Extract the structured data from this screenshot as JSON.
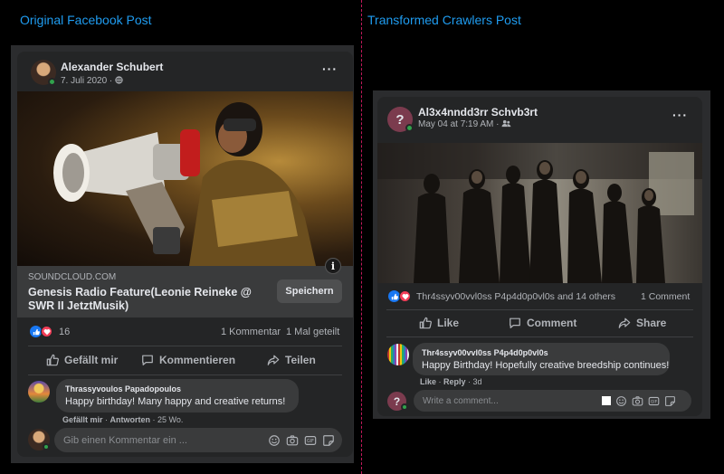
{
  "titles": {
    "left": "Original Facebook Post",
    "right": "Transformed Crawlers Post"
  },
  "original": {
    "author": "Alexander Schubert",
    "date": "7. Juli 2020 ·",
    "link": {
      "domain": "SOUNDCLOUD.COM",
      "title": "Genesis Radio Feature(Leonie Reineke @ SWR II JetztMusik)",
      "save_label": "Speichern",
      "info_label": "i"
    },
    "reactions_count": "16",
    "comments_count": "1 Kommentar",
    "shares_count": "1 Mal geteilt",
    "actions": {
      "like": "Gefällt mir",
      "comment": "Kommentieren",
      "share": "Teilen"
    },
    "comment": {
      "author": "Thrassyvoulos Papadopoulos",
      "text": "Happy birthday! Many happy and creative returns!",
      "like": "Gefällt mir",
      "reply": "Antworten",
      "time": "25 Wo."
    },
    "input_placeholder": "Gib einen Kommentar ein ..."
  },
  "transformed": {
    "author": "Al3x4nndd3rr Schvb3rt",
    "date": "May 04 at 7:19 AM ·",
    "avatar_char": "?",
    "reactions_text": "Thr4ssyv00vvl0ss P4p4d0p0vl0s and 14 others",
    "comments_count": "1 Comment",
    "actions": {
      "like": "Like",
      "comment": "Comment",
      "share": "Share"
    },
    "comment": {
      "author": "Thr4ssyv00vvl0ss P4p4d0p0vl0s",
      "text": "Happy Birthday! Hopefully creative breedship continues!",
      "like": "Like",
      "reply": "Reply",
      "time": "3d"
    },
    "input_placeholder": "Write a comment..."
  },
  "colors": {
    "accent_title": "#1f9cf0",
    "divider": "#c2185b",
    "card_bg": "#242526",
    "bubble_bg": "#3a3b3c",
    "online": "#31a24c",
    "like_blue": "#1877f2",
    "love_red": "#f33e58"
  }
}
